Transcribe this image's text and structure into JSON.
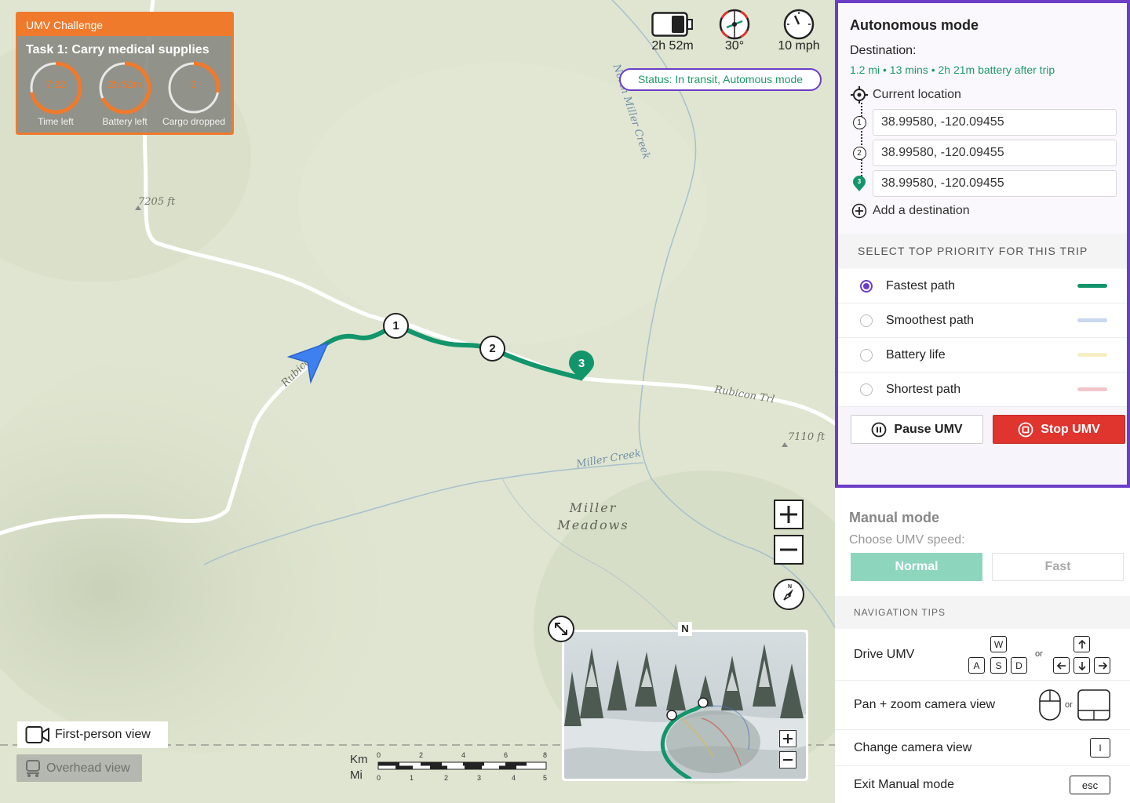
{
  "challenge": {
    "header": "UMV Challenge",
    "task": "Task 1: Carry medical supplies",
    "gauges": [
      {
        "value": "7:32",
        "label": "Time left",
        "progress": 0.72
      },
      {
        "value": "2h 52m",
        "label": "Battery left",
        "progress": 0.68
      },
      {
        "value": "3",
        "label": "Cargo dropped",
        "progress": 0.28
      }
    ]
  },
  "indicators": {
    "battery": "2h 52m",
    "heading": "30°",
    "speed": "10 mph"
  },
  "status": "Status: In transit, Automous mode",
  "map": {
    "elevation_1": "7205 ft",
    "elevation_2": "7110 ft",
    "creek_north": "North Miller Creek",
    "creek": "Miller Creek",
    "meadow_line1": "Miller",
    "meadow_line2": "Meadows",
    "trail_label_1": "Rubicon Trl",
    "trail_label_2": "Rubicon Trl",
    "waypoints": [
      "1",
      "2",
      "3"
    ]
  },
  "views": {
    "first_person": "First-person view",
    "overhead": "Overhead view"
  },
  "scale": {
    "km_label": "Km",
    "mi_label": "Mi",
    "km_ticks": [
      "0",
      "2",
      "4",
      "6",
      "8"
    ],
    "mi_ticks": [
      "0",
      "1",
      "2",
      "3",
      "4",
      "5"
    ]
  },
  "minimap": {
    "north": "N"
  },
  "autonomous": {
    "title": "Autonomous mode",
    "destination_label": "Destination:",
    "destination_info": "1.2 mi • 13 mins • 2h 21m battery after trip",
    "current_location": "Current location",
    "waypoints": [
      {
        "num": "1",
        "value": "38.99580, -120.09455"
      },
      {
        "num": "2",
        "value": "38.99580, -120.09455"
      },
      {
        "num": "3",
        "value": "38.99580, -120.09455"
      }
    ],
    "add_destination": "Add a destination",
    "priority_header": "SELECT TOP PRIORITY FOR THIS TRIP",
    "priorities": [
      {
        "label": "Fastest path",
        "color": "#12956a",
        "selected": true
      },
      {
        "label": "Smoothest path",
        "color": "#c9d7ef",
        "selected": false
      },
      {
        "label": "Battery life",
        "color": "#f7efc4",
        "selected": false
      },
      {
        "label": "Shortest path",
        "color": "#f1c6cb",
        "selected": false
      }
    ],
    "pause_label": "Pause UMV",
    "stop_label": "Stop UMV"
  },
  "manual": {
    "title": "Manual mode",
    "speed_label": "Choose UMV speed:",
    "normal": "Normal",
    "fast": "Fast",
    "tips_header": "NAVIGATION TIPS",
    "tips": [
      {
        "label": "Drive UMV"
      },
      {
        "label": "Pan + zoom camera view"
      },
      {
        "label": "Change camera view"
      },
      {
        "label": "Exit Manual mode"
      }
    ],
    "keys": {
      "w": "W",
      "a": "A",
      "s": "S",
      "d": "D",
      "i": "I",
      "esc": "esc",
      "or": "or"
    }
  },
  "colors": {
    "accent": "#6b3ec6",
    "route": "#12956a",
    "challenge": "#f07a2c",
    "stop": "#e0342f"
  }
}
